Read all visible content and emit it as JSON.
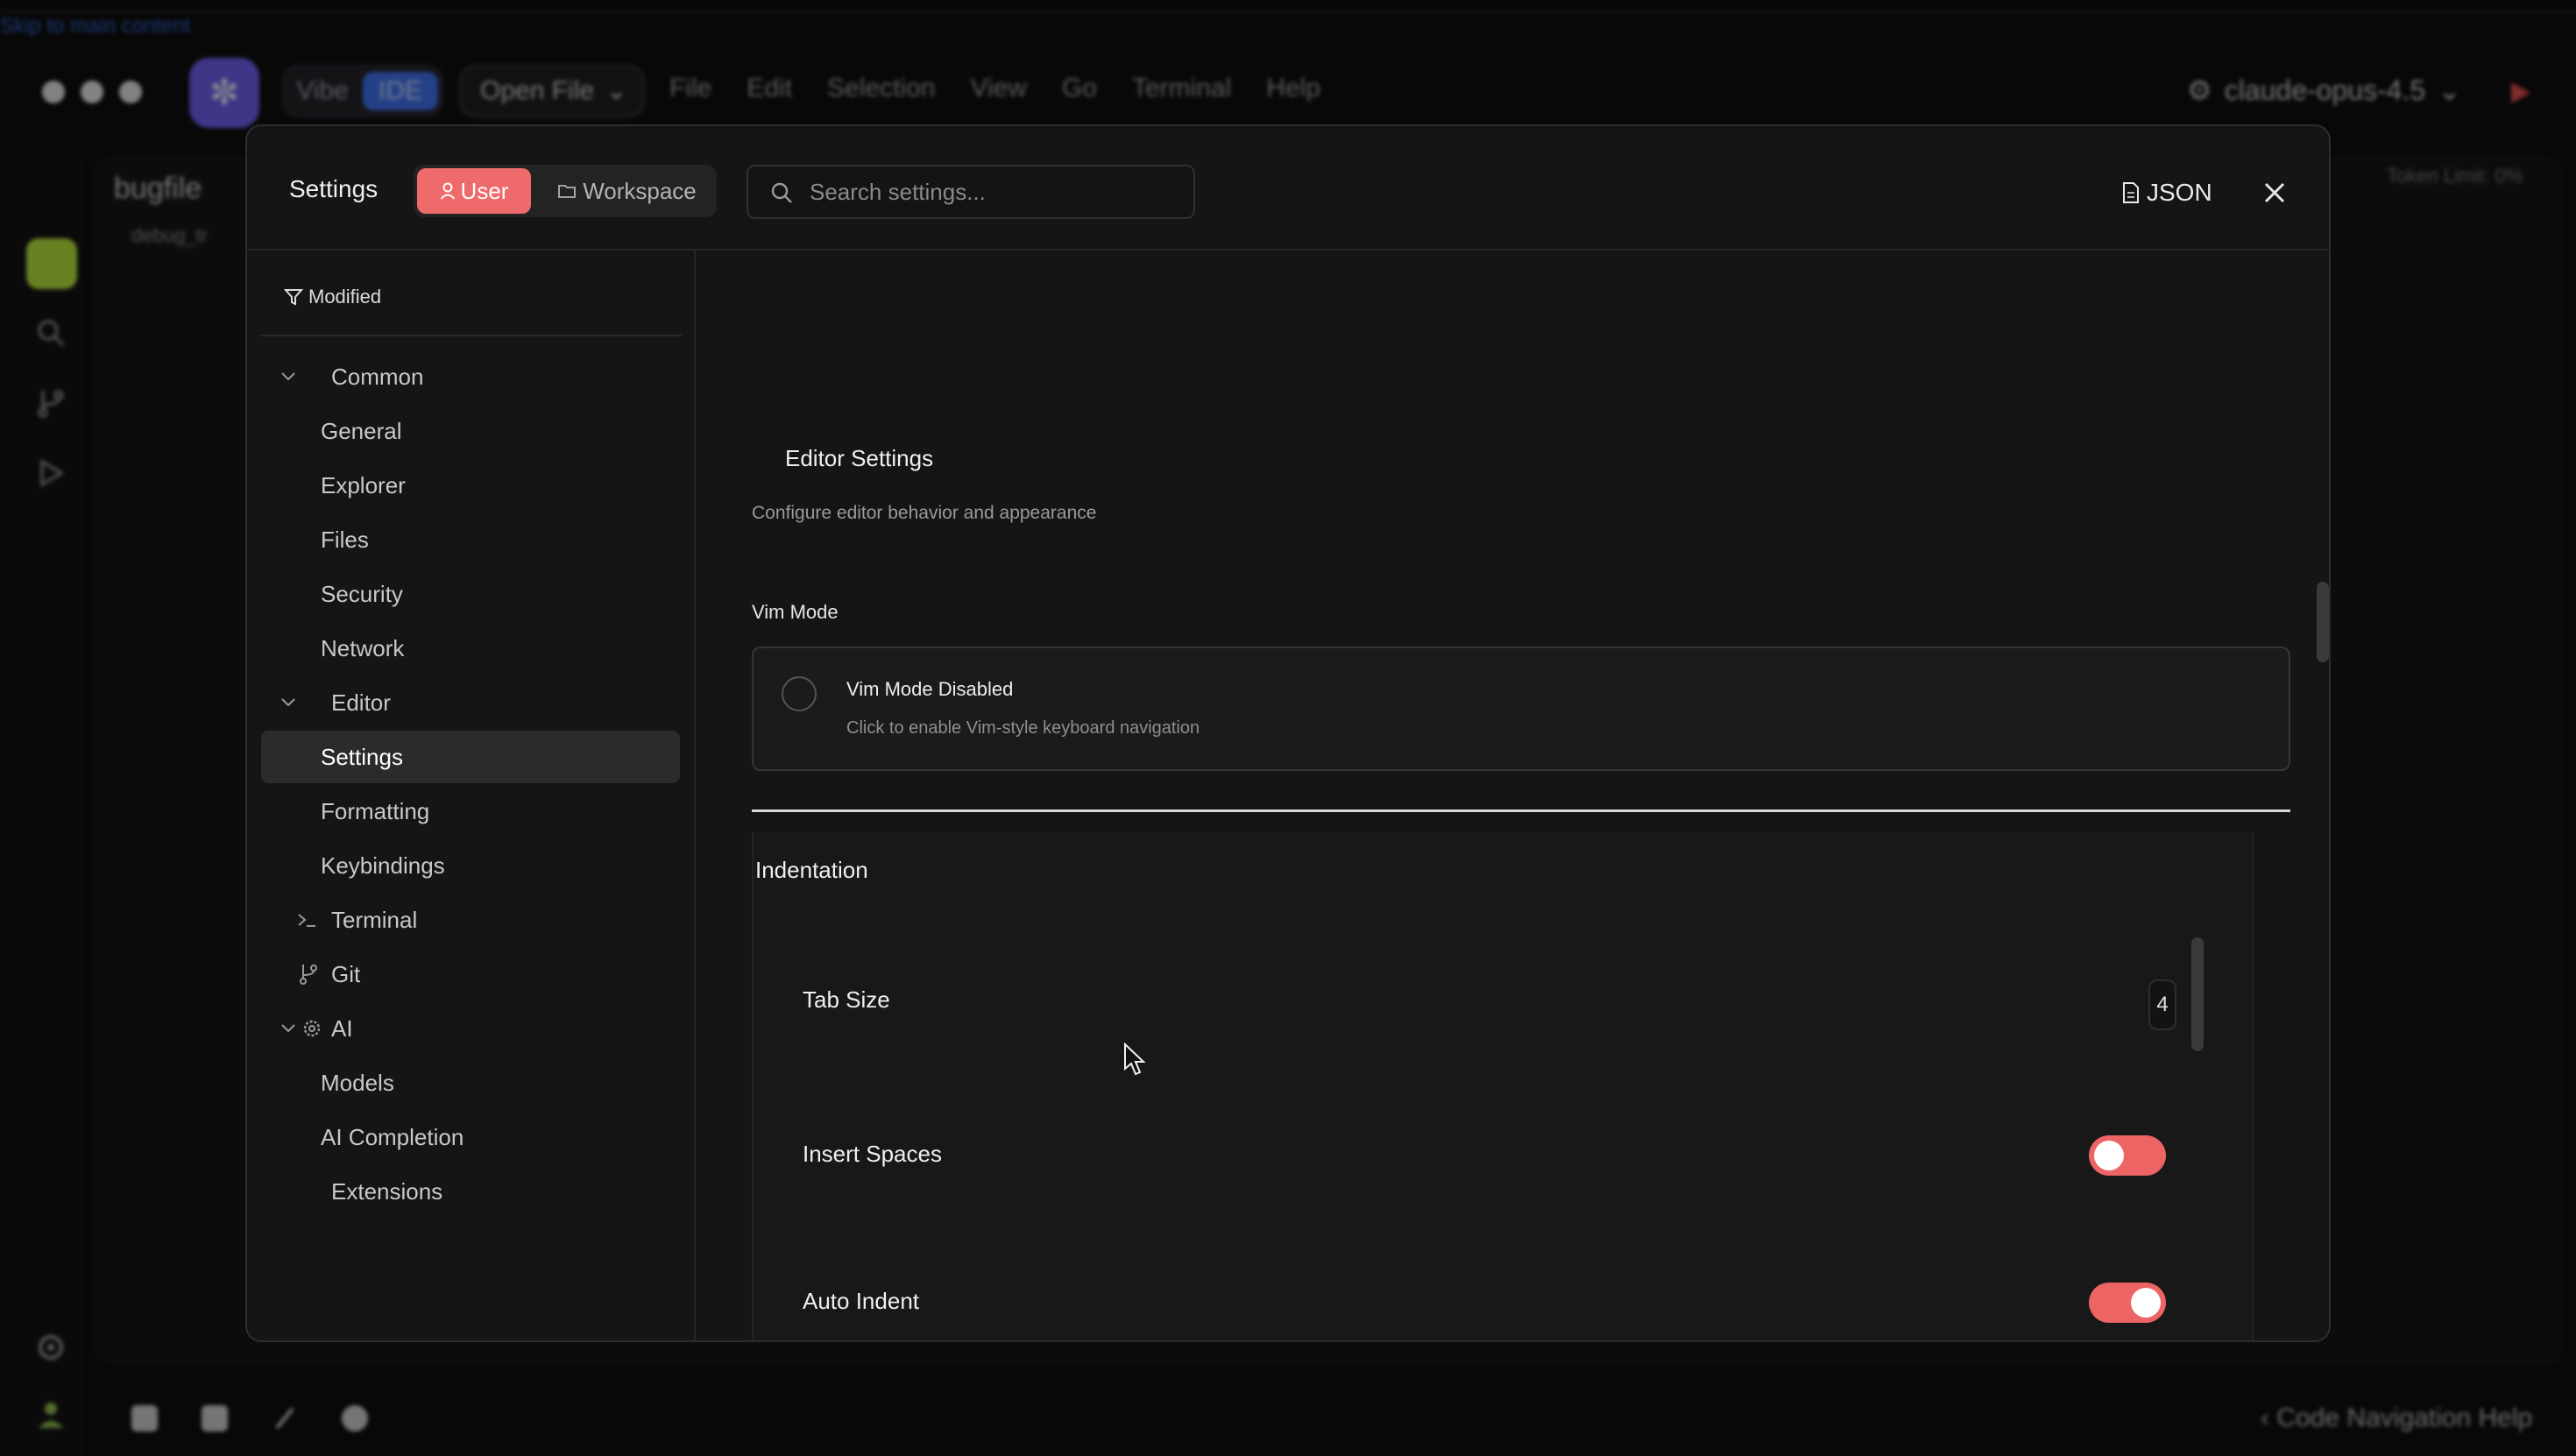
{
  "background_ide": {
    "skip_link": "Skip to main content",
    "mode_switch": {
      "vibe": "Vibe",
      "ide": "IDE"
    },
    "open_file": "Open File",
    "menu": [
      "File",
      "Edit",
      "Selection",
      "View",
      "Go",
      "Terminal",
      "Help"
    ],
    "model": "claude-opus-4.5",
    "file_title": "bugfile",
    "file_sub": "debug_tr",
    "token_limit": "Token Limit: 0%",
    "code_help": "Code Navigation Help"
  },
  "settings": {
    "title": "Settings",
    "scopes": {
      "user": "User",
      "workspace": "Workspace"
    },
    "search_placeholder": "Search settings...",
    "json_label": "JSON",
    "filter_label": "Modified",
    "nav": [
      {
        "label": "Common",
        "type": "group"
      },
      {
        "label": "General",
        "type": "item"
      },
      {
        "label": "Explorer",
        "type": "item"
      },
      {
        "label": "Files",
        "type": "item"
      },
      {
        "label": "Security",
        "type": "item"
      },
      {
        "label": "Network",
        "type": "item"
      },
      {
        "label": "Editor",
        "type": "group"
      },
      {
        "label": "Settings",
        "type": "item",
        "active": true
      },
      {
        "label": "Formatting",
        "type": "item"
      },
      {
        "label": "Keybindings",
        "type": "item"
      },
      {
        "label": "Terminal",
        "type": "group-collapsed",
        "icon": "terminal-icon"
      },
      {
        "label": "Git",
        "type": "group-collapsed",
        "icon": "git-branch-icon"
      },
      {
        "label": "AI",
        "type": "group",
        "icon": "gear-icon"
      },
      {
        "label": "Models",
        "type": "item"
      },
      {
        "label": "AI Completion",
        "type": "item"
      },
      {
        "label": "Extensions",
        "type": "group-collapsed"
      }
    ],
    "section": {
      "title": "Editor Settings",
      "description": "Configure editor behavior and appearance"
    },
    "vim": {
      "label": "Vim Mode",
      "title": "Vim Mode Disabled",
      "subtitle": "Click to enable Vim-style keyboard navigation",
      "enabled": false
    },
    "indentation": {
      "title": "Indentation",
      "tab_size_label": "Tab Size",
      "tab_size_value": "4",
      "insert_spaces_label": "Insert Spaces",
      "insert_spaces_on": false,
      "auto_indent_label": "Auto Indent",
      "auto_indent_on": true
    }
  },
  "colors": {
    "accent": "#ec6464",
    "ide_mode": "#3c6ff0",
    "explorer_active": "#b8e63a",
    "logo": "#6b5cf0"
  }
}
